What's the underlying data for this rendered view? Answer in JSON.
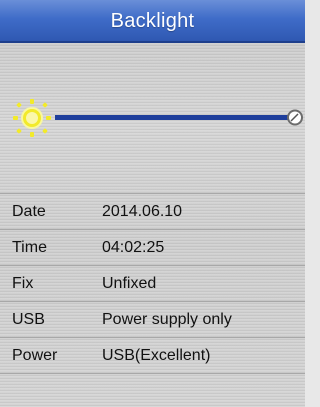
{
  "title": "Backlight",
  "backlight": {
    "level": 1.0,
    "icon": "sun-icon",
    "track_color": "#1f3f9c",
    "icon_color": "#f2ea2a"
  },
  "info": [
    {
      "label": "Date",
      "value": "2014.06.10"
    },
    {
      "label": "Time",
      "value": "04:02:25"
    },
    {
      "label": "Fix",
      "value": "Unfixed"
    },
    {
      "label": "USB",
      "value": "Power supply only"
    },
    {
      "label": "Power",
      "value": "USB(Excellent)"
    }
  ],
  "colors": {
    "title_bar": "#3f6cc8",
    "background": "#d0d0d0"
  }
}
